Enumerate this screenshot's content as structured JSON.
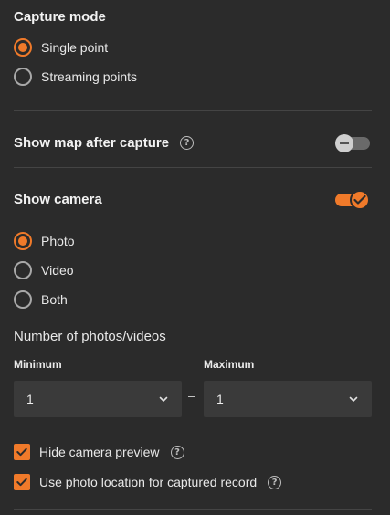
{
  "capture_mode": {
    "title": "Capture mode",
    "options": [
      {
        "label": "Single point",
        "selected": true
      },
      {
        "label": "Streaming points",
        "selected": false
      }
    ]
  },
  "show_map": {
    "label": "Show map after capture",
    "help_icon": "help-circle-icon",
    "enabled": false
  },
  "show_camera": {
    "label": "Show camera",
    "enabled": true,
    "options": [
      {
        "label": "Photo",
        "selected": true
      },
      {
        "label": "Video",
        "selected": false
      },
      {
        "label": "Both",
        "selected": false
      }
    ]
  },
  "count": {
    "title": "Number of photos/videos",
    "min_label": "Minimum",
    "max_label": "Maximum",
    "min_value": "1",
    "max_value": "1",
    "separator": "–"
  },
  "checks": {
    "hide_preview": {
      "label": "Hide camera preview",
      "checked": true
    },
    "use_location": {
      "label": "Use photo location for captured record",
      "checked": true
    }
  },
  "colors": {
    "accent": "#f07a2a",
    "background": "#2b2b2b",
    "field": "#3a3a3a"
  }
}
